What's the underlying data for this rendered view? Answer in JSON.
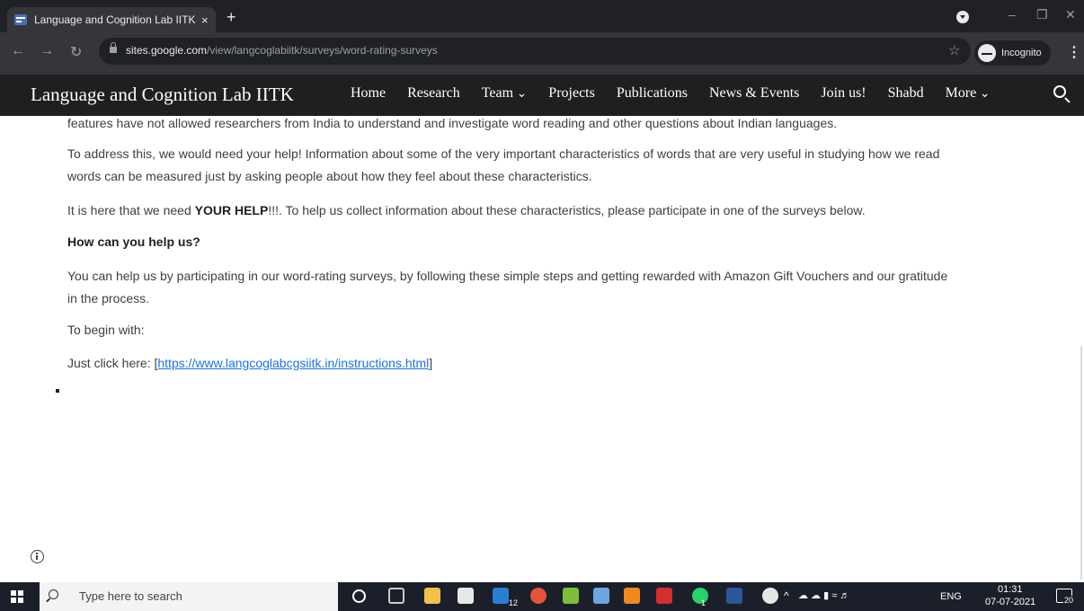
{
  "browser": {
    "tab_title": "Language and Cognition Lab IITK",
    "tab_close": "×",
    "new_tab": "+",
    "url_host": "sites.google.com",
    "url_path": "/view/langcoglabiitk/surveys/word-rating-surveys",
    "incognito_label": "Incognito"
  },
  "site": {
    "title": "Language and Cognition Lab IITK",
    "nav": [
      "Home",
      "Research",
      "Team",
      "Projects",
      "Publications",
      "News & Events",
      "Join us!",
      "Shabd",
      "More"
    ]
  },
  "content": {
    "p1": "features have not allowed researchers from India to understand and investigate word reading and other questions about Indian languages.",
    "p2_line1": "To address this, we would need your help! Information about some of the very important characteristics of words that are very useful in studying how we read",
    "p2_line2": "words can be measured just by asking people about how they feel about these characteristics.",
    "p3_pre": "It is here that we need ",
    "p3_bold": "YOUR HELP",
    "p3_post": "!!!. To help us collect information about these characteristics, please participate in one of the surveys below.",
    "heading": "How can you help us?",
    "p4_line1": "You can help us by participating in our word-rating surveys, by following these simple steps and getting rewarded with Amazon Gift Vouchers and our gratitude",
    "p4_line2": "in the process.",
    "p5": "To begin with:",
    "p6_pre": "Just click here: [",
    "p6_link": "https://www.langcoglabcgsiitk.in/instructions.html",
    "p6_post": "]"
  },
  "taskbar": {
    "search_placeholder": "Type here to search",
    "mail_badge": "12",
    "whatsapp_badge": "1",
    "lang": "ENG",
    "time": "01:31",
    "date": "07-07-2021",
    "notif_count": "20"
  }
}
